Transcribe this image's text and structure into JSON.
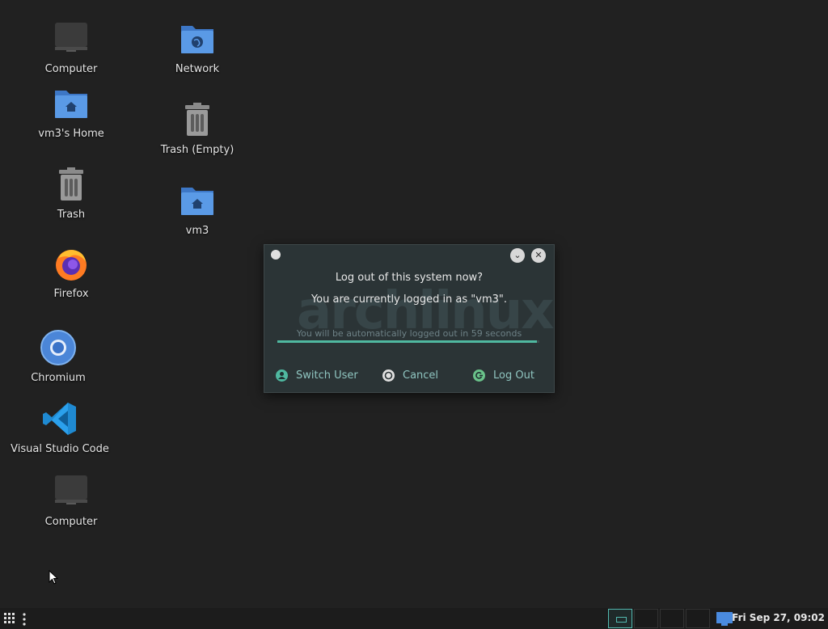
{
  "desktop": {
    "icons": [
      {
        "label": "Computer",
        "icon": "computer-icon"
      },
      {
        "label": "vm3's Home",
        "icon": "home-folder-icon"
      },
      {
        "label": "Trash",
        "icon": "trash-icon"
      },
      {
        "label": "Firefox",
        "icon": "firefox-icon"
      },
      {
        "label": "Chromium",
        "icon": "chromium-icon"
      },
      {
        "label": "Visual Studio Code",
        "icon": "vscode-icon"
      },
      {
        "label": "Computer",
        "icon": "computer-icon"
      },
      {
        "label": "Network",
        "icon": "network-folder-icon"
      },
      {
        "label": "Trash (Empty)",
        "icon": "trash-icon"
      },
      {
        "label": "vm3",
        "icon": "home-folder-icon"
      }
    ]
  },
  "dialog": {
    "question": "Log out of this system now?",
    "logged_in": "You are currently logged in as \"vm3\".",
    "countdown": "You will be automatically logged out in 59 seconds",
    "watermark": "archlinux",
    "progress": 0.99,
    "buttons": {
      "switch_user": "Switch User",
      "cancel": "Cancel",
      "log_out": "Log Out"
    }
  },
  "taskbar": {
    "clock": "Fri Sep 27, 09:02",
    "accent": "#53b9b0"
  }
}
